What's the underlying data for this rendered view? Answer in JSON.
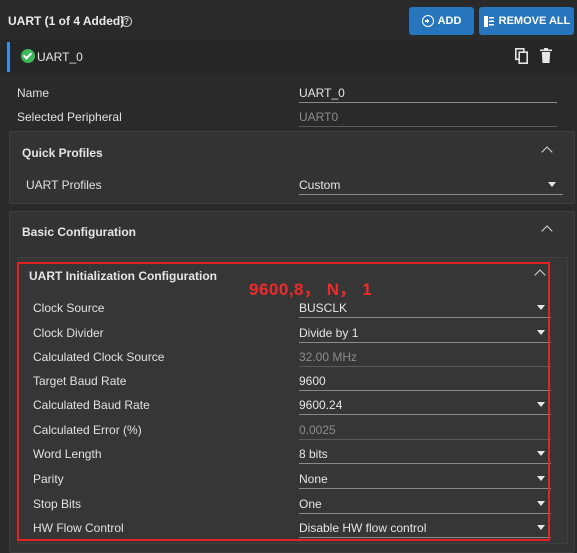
{
  "header": {
    "title": "UART (1 of 4 Added)",
    "add_label": "ADD",
    "remove_all_label": "REMOVE ALL"
  },
  "instance": {
    "name": "UART_0",
    "status": "ok"
  },
  "fields": {
    "name": {
      "label": "Name",
      "value": "UART_0"
    },
    "selected_peripheral": {
      "label": "Selected Peripheral",
      "value": "UART0"
    }
  },
  "quick_profiles": {
    "title": "Quick Profiles",
    "uart_profiles": {
      "label": "UART Profiles",
      "value": "Custom"
    }
  },
  "basic_config": {
    "title": "Basic Configuration",
    "init": {
      "title": "UART Initialization Configuration",
      "annotation": "9600,8， N， 1",
      "rows": [
        {
          "label": "Clock Source",
          "value": "BUSCLK"
        },
        {
          "label": "Clock Divider",
          "value": "Divide by 1"
        },
        {
          "label": "Calculated Clock Source",
          "value": "32.00 MHz"
        },
        {
          "label": "Target Baud Rate",
          "value": "9600"
        },
        {
          "label": "Calculated Baud Rate",
          "value": "9600.24"
        },
        {
          "label": "Calculated Error (%)",
          "value": "0.0025"
        },
        {
          "label": "Word Length",
          "value": "8 bits"
        },
        {
          "label": "Parity",
          "value": "None"
        },
        {
          "label": "Stop Bits",
          "value": "One"
        },
        {
          "label": "HW Flow Control",
          "value": "Disable HW flow control"
        }
      ]
    }
  },
  "colors": {
    "accent_blue": "#2775bd",
    "status_green": "#3cb85a",
    "annotation_red": "#e02424"
  }
}
